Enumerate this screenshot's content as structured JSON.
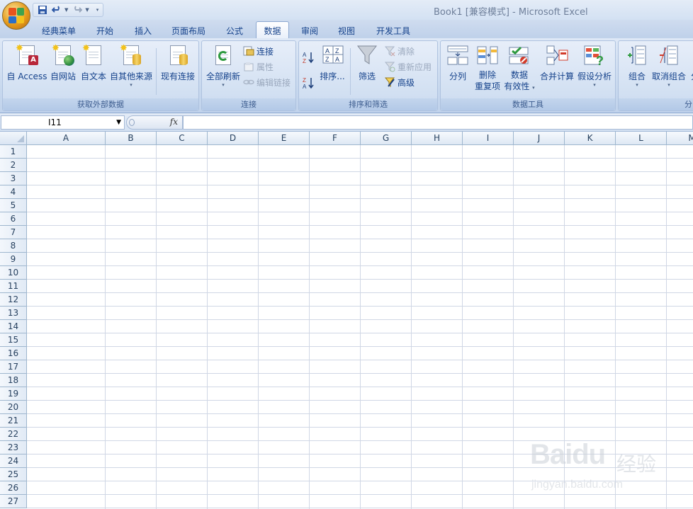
{
  "window": {
    "title": "Book1  [兼容模式] - Microsoft Excel"
  },
  "tabs": [
    {
      "label": "经典菜单"
    },
    {
      "label": "开始"
    },
    {
      "label": "插入"
    },
    {
      "label": "页面布局"
    },
    {
      "label": "公式"
    },
    {
      "label": "数据"
    },
    {
      "label": "审阅"
    },
    {
      "label": "视图"
    },
    {
      "label": "开发工具"
    }
  ],
  "ribbon": {
    "external": {
      "label": "获取外部数据",
      "access": "自 Access",
      "web": "自网站",
      "text": "自文本",
      "other": "自其他来源",
      "existing": "现有连接"
    },
    "connections": {
      "label": "连接",
      "refresh_all": "全部刷新",
      "connections": "连接",
      "properties": "属性",
      "edit_links": "编辑链接"
    },
    "sort_filter": {
      "label": "排序和筛选",
      "sort": "排序...",
      "filter": "筛选",
      "clear": "清除",
      "reapply": "重新应用",
      "advanced": "高级"
    },
    "data_tools": {
      "label": "数据工具",
      "text_to_columns": "分列",
      "remove_dup_1": "删除",
      "remove_dup_2": "重复项",
      "validation_1": "数据",
      "validation_2": "有效性",
      "consolidate": "合并计算",
      "what_if": "假设分析"
    },
    "outline": {
      "label": "分",
      "group": "组合",
      "ungroup": "取消组合",
      "subtotal": "分"
    }
  },
  "formula_bar": {
    "name_box": "I11",
    "fx": "fx",
    "formula": ""
  },
  "columns": [
    "A",
    "B",
    "C",
    "D",
    "E",
    "F",
    "G",
    "H",
    "I",
    "J",
    "K",
    "L",
    "M"
  ],
  "rows": [
    "1",
    "2",
    "3",
    "4",
    "5",
    "6",
    "7",
    "8",
    "9",
    "10",
    "11",
    "12",
    "13",
    "14",
    "15",
    "16",
    "17",
    "18",
    "19",
    "20",
    "21",
    "22",
    "23",
    "24",
    "25",
    "26",
    "27"
  ],
  "watermark": {
    "brand": "Bai",
    "brand2": "du",
    "cn": "经验",
    "url": "jingyan.baidu.com"
  },
  "colors": {
    "ribbon_bg": "#c7d8ee",
    "tab_text": "#15428b",
    "gridline": "#d0d7e5",
    "header_border": "#9eb6ce"
  }
}
